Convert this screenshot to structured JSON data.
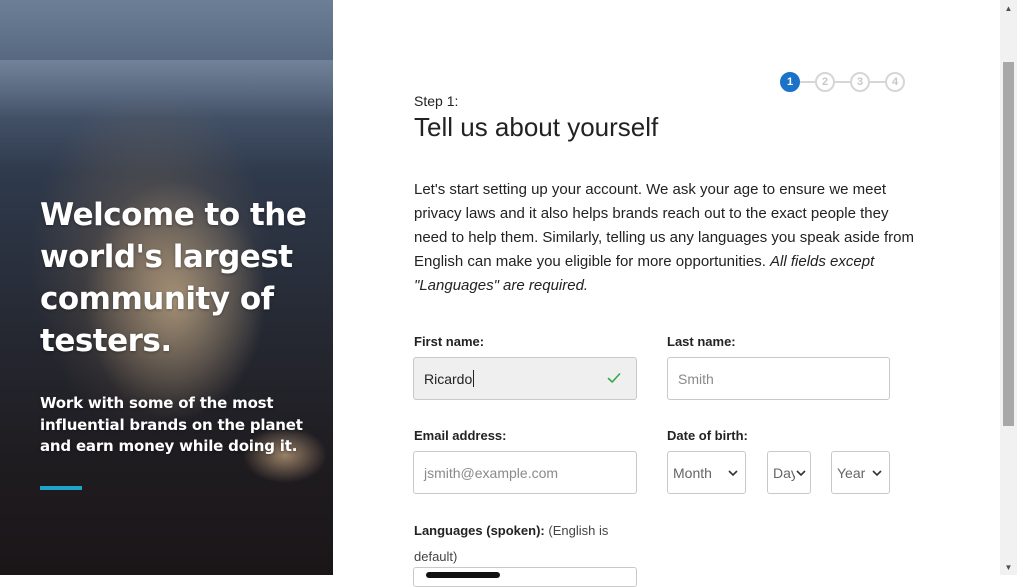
{
  "hero": {
    "title": "Welcome to the world's largest community of testers.",
    "subtitle": "Work with some of the most influential brands on the planet and earn money while doing it.",
    "accent_color": "#1fa3c9"
  },
  "stepper": {
    "steps": [
      "1",
      "2",
      "3",
      "4"
    ],
    "current": 1,
    "active_color": "#1a73c9"
  },
  "header": {
    "step_label": "Step 1:",
    "title": "Tell us about yourself"
  },
  "intro": {
    "text": "Let's start setting up your account. We ask your age to ensure we meet privacy laws and it also helps brands reach out to the exact people they need to help them. Similarly, telling us any languages you speak aside from English can make you eligible for more opportunities.",
    "emphasis": "All fields except \"Languages\" are required."
  },
  "form": {
    "first_name": {
      "label": "First name:",
      "value": "Ricardo",
      "valid_icon": "check-icon"
    },
    "last_name": {
      "label": "Last name:",
      "placeholder": "Smith"
    },
    "email": {
      "label": "Email address:",
      "placeholder": "jsmith@example.com"
    },
    "dob": {
      "label": "Date of birth:",
      "month": "Month",
      "day": "Day",
      "year": "Year"
    },
    "languages": {
      "label": "Languages (spoken):",
      "note": "(English is default)"
    }
  },
  "scrollbar": {
    "up_icon": "triangle-up-icon",
    "down_icon": "triangle-down-icon"
  }
}
